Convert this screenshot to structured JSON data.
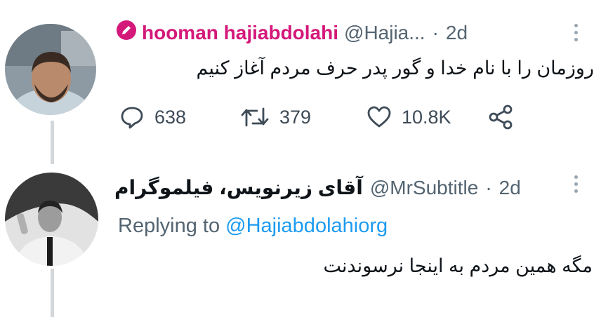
{
  "colors": {
    "text": "#0f1419",
    "secondary": "#536471",
    "link": "#1d9bf0",
    "verified_magenta": "#d4187a",
    "thread_line": "#d3d7da"
  },
  "tweet1": {
    "badge_icon": "pencil-badge-icon",
    "display_name": "hooman hajiabdolahi",
    "handle": "@Hajia...",
    "separator": "·",
    "time": "2d",
    "text": "روزمان را با نام خدا و گور پدر حرف مردم آغاز کنیم",
    "actions": {
      "reply_count": "638",
      "retweet_count": "379",
      "like_count": "10.8K"
    }
  },
  "tweet2": {
    "display_name": "آقای زیرنویس، فیلموگرام",
    "handle": "@MrSubtitle",
    "separator": "·",
    "time": "2d",
    "replying_prefix": "Replying to",
    "replying_handle": "@Hajiabdolahiorg",
    "text": "مگه همین مردم به اینجا نرسوندنت"
  }
}
